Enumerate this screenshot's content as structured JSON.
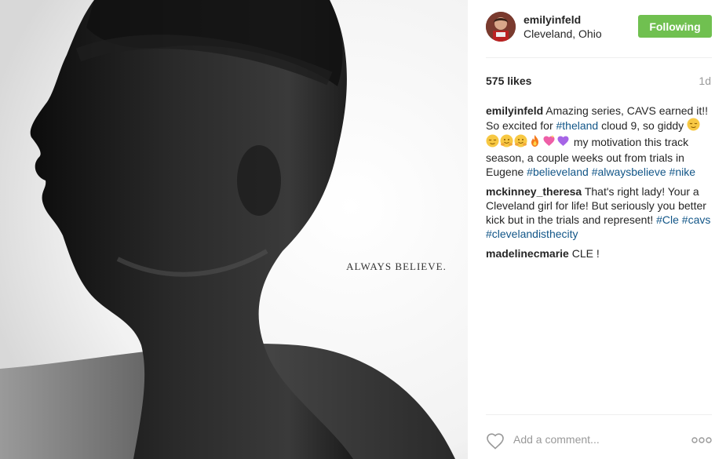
{
  "photo": {
    "overlay_text": "ALWAYS BELIEVE."
  },
  "post": {
    "username": "emilyinfeld",
    "location": "Cleveland, Ohio",
    "follow_label": "Following",
    "likes": "575 likes",
    "time_ago": "1d"
  },
  "comments": [
    {
      "user": "emilyinfeld",
      "segments": [
        {
          "type": "text",
          "value": "Amazing series, CAVS earned it!! So excited for "
        },
        {
          "type": "tag",
          "value": "#theland"
        },
        {
          "type": "text",
          "value": " cloud 9, so giddy "
        },
        {
          "type": "emoji",
          "value": "relieved-face"
        },
        {
          "type": "emoji",
          "value": "relieved-face"
        },
        {
          "type": "emoji",
          "value": "hugging-face"
        },
        {
          "type": "emoji",
          "value": "hugging-face"
        },
        {
          "type": "emoji",
          "value": "fire"
        },
        {
          "type": "emoji",
          "value": "sparkling-heart"
        },
        {
          "type": "emoji",
          "value": "purple-heart"
        },
        {
          "type": "text",
          "value": " my motivation this track season, a couple weeks out from trials in Eugene "
        },
        {
          "type": "tag",
          "value": "#believeland"
        },
        {
          "type": "text",
          "value": " "
        },
        {
          "type": "tag",
          "value": "#alwaysbelieve"
        },
        {
          "type": "text",
          "value": " "
        },
        {
          "type": "tag",
          "value": "#nike"
        }
      ]
    },
    {
      "user": "mckinney_theresa",
      "segments": [
        {
          "type": "text",
          "value": "That's right lady! Your a Cleveland girl for life! But seriously you better kick but in the trials and represent! "
        },
        {
          "type": "tag",
          "value": "#Cle"
        },
        {
          "type": "text",
          "value": " "
        },
        {
          "type": "tag",
          "value": "#cavs"
        },
        {
          "type": "text",
          "value": " "
        },
        {
          "type": "tag",
          "value": "#clevelandisthecity"
        }
      ]
    },
    {
      "user": "madelinecmarie",
      "segments": [
        {
          "type": "text",
          "value": "CLE !"
        }
      ]
    }
  ],
  "add_comment": {
    "placeholder": "Add a comment..."
  },
  "icons": {
    "like": "heart-outline-icon",
    "more": "more-options-icon"
  },
  "colors": {
    "follow_button": "#70c050",
    "hashtag": "#125688"
  }
}
